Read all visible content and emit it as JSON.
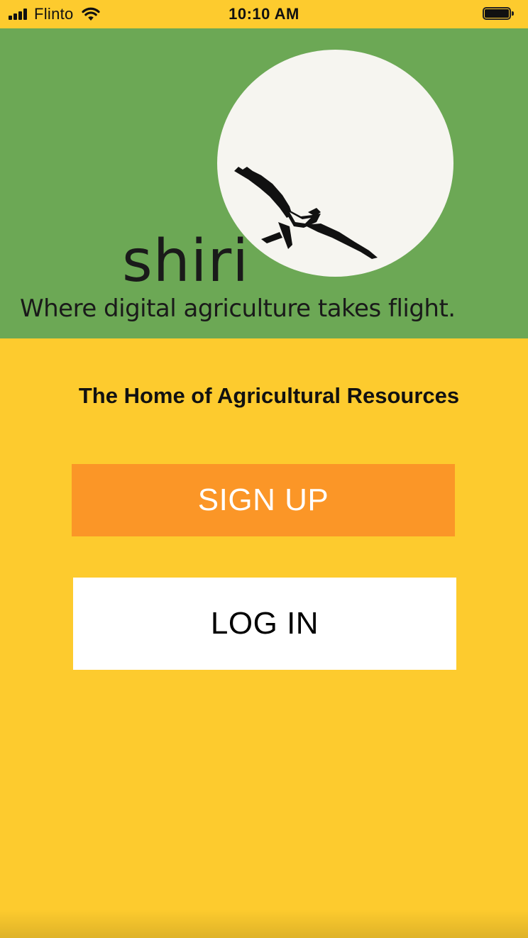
{
  "status_bar": {
    "carrier": "Flinto",
    "time": "10:10 AM",
    "signal_icon": "cellular-signal-icon",
    "wifi_icon": "wifi-icon",
    "battery_icon": "battery-icon"
  },
  "banner": {
    "logo_text": "shiri",
    "tagline": "Where digital agriculture takes flight.",
    "logo_icon": "bird-icon",
    "background_color": "#6CA855"
  },
  "main": {
    "headline": "The Home of Agricultural Resources",
    "signup_label": "SIGN UP",
    "login_label": "LOG IN"
  },
  "colors": {
    "page_background": "#FDCB2E",
    "signup_button": "#FB9627",
    "login_button": "#FFFFFF"
  }
}
